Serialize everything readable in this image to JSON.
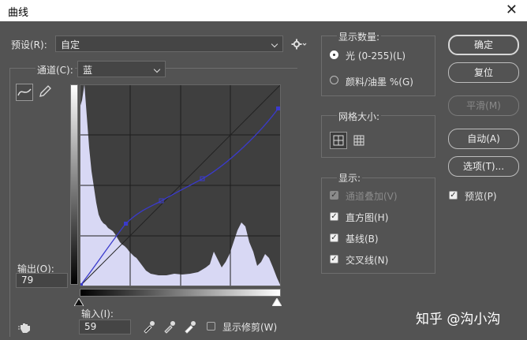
{
  "window": {
    "title": "曲线"
  },
  "preset": {
    "label": "预设(R):",
    "value": "自定"
  },
  "channel": {
    "label": "通道(C):",
    "value": "蓝"
  },
  "output": {
    "label": "输出(O):",
    "value": "79"
  },
  "input": {
    "label": "输入(I):",
    "value": "59"
  },
  "show_clipping": {
    "label": "显示修剪(W)",
    "checked": false
  },
  "show_amount": {
    "title": "显示数量:",
    "options": [
      {
        "label": "光 (0-255)(L)",
        "selected": true
      },
      {
        "label": "颜料/油墨 %(G)",
        "selected": false
      }
    ]
  },
  "grid_size": {
    "title": "网格大小:"
  },
  "display": {
    "title": "显示:",
    "items": [
      {
        "label": "通道叠加(V)",
        "checked": true,
        "disabled": true
      },
      {
        "label": "直方图(H)",
        "checked": true,
        "disabled": false
      },
      {
        "label": "基线(B)",
        "checked": true,
        "disabled": false
      },
      {
        "label": "交叉线(N)",
        "checked": true,
        "disabled": false
      }
    ]
  },
  "buttons": {
    "ok": "确定",
    "reset": "复位",
    "smooth": "平滑(M)",
    "auto": "自动(A)",
    "options": "选项(T)..."
  },
  "preview": {
    "label": "预览(P)",
    "checked": true
  },
  "watermark": "知乎 @沟小沟",
  "colors": {
    "curve": "#3a3acc",
    "histogram": "#d8d8f4",
    "graph_bg": "#3f3f3f"
  },
  "icons": [
    "close-icon",
    "gear-icon",
    "curve-tool-icon",
    "pencil-icon",
    "eyedropper-black-icon",
    "eyedropper-gray-icon",
    "eyedropper-white-icon",
    "hand-adjust-icon",
    "grid-4-icon",
    "grid-10-icon"
  ]
}
